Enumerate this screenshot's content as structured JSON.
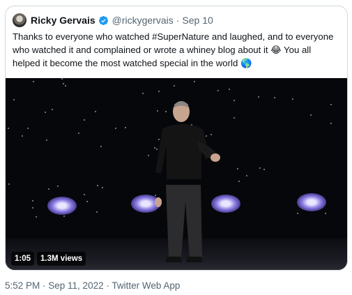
{
  "tweet": {
    "author": {
      "display_name": "Ricky Gervais",
      "handle": "@rickygervais",
      "verified": true
    },
    "separator": "·",
    "date": "Sep 10",
    "text_lines": [
      "Thanks to everyone who watched #SuperNature and laughed, and to everyone",
      "who watched it and complained or wrote a whiney blog about it 😂 You all",
      "helped it become the most watched special in the world 🌎"
    ],
    "video": {
      "duration": "1:05",
      "views": "1.3M views"
    },
    "footer": "5:52 PM · Sep 11, 2022 · Twitter Web App"
  },
  "colors": {
    "verified_blue": "#1d9bf0",
    "secondary_text": "#536471",
    "primary_text": "#0f1419",
    "border": "#cfd9de"
  }
}
